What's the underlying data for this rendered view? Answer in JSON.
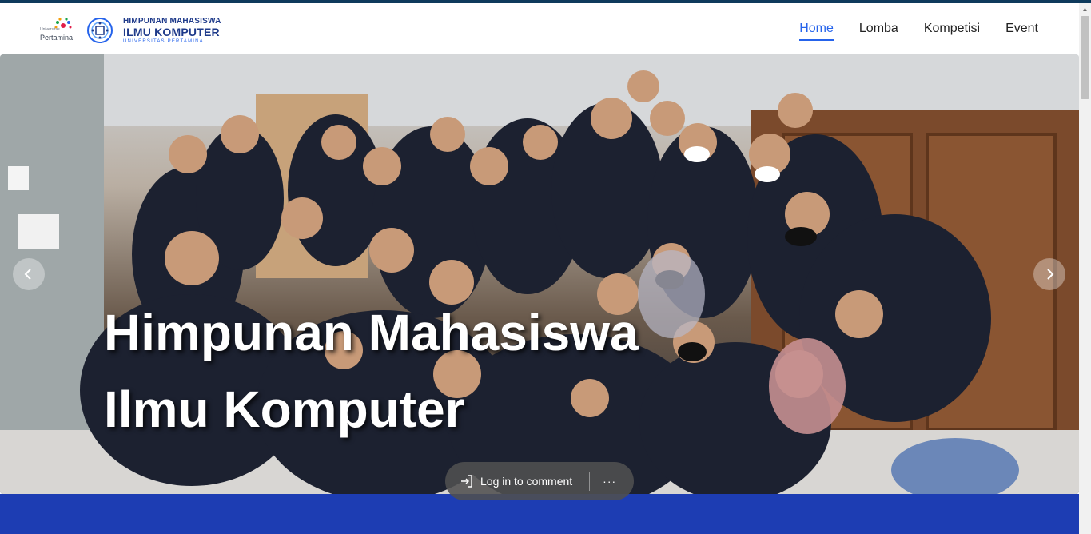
{
  "navbar": {
    "logo_pertamina": {
      "tagline": "Universitas",
      "word": "Pertamina"
    },
    "logo_hmik": {
      "line1": "HIMPUNAN MAHASISWA",
      "line2": "ILMU KOMPUTER",
      "line3": "UNIVERSITAS PERTAMINA"
    },
    "links": [
      {
        "label": "Home",
        "active": true
      },
      {
        "label": "Lomba",
        "active": false
      },
      {
        "label": "Kompetisi",
        "active": false
      },
      {
        "label": "Event",
        "active": false
      }
    ]
  },
  "hero": {
    "title_line1": "Himpunan Mahasiswa",
    "title_line2": "Ilmu Komputer",
    "prev_icon": "chevron-left-icon",
    "next_icon": "chevron-right-icon"
  },
  "comment_bar": {
    "label": "Log in to comment",
    "more": "···",
    "icon": "login-icon"
  },
  "colors": {
    "accent": "#2563eb",
    "brand_blue": "#1d3db3",
    "top_strip": "#0e3a5c"
  }
}
